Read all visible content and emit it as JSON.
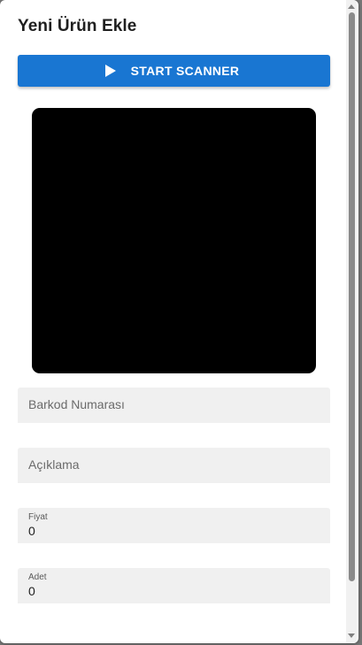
{
  "dialog": {
    "title": "Yeni Ürün Ekle",
    "scanner_button": {
      "label": "START SCANNER",
      "icon": "play-icon",
      "color": "#1976d2"
    },
    "camera_preview": {
      "background": "#000000"
    },
    "fields": {
      "barcode": {
        "placeholder": "Barkod Numarası",
        "value": ""
      },
      "description": {
        "placeholder": "Açıklama",
        "value": ""
      },
      "price": {
        "label": "Fiyat",
        "value": "0"
      },
      "quantity": {
        "label": "Adet",
        "value": "0"
      }
    }
  }
}
